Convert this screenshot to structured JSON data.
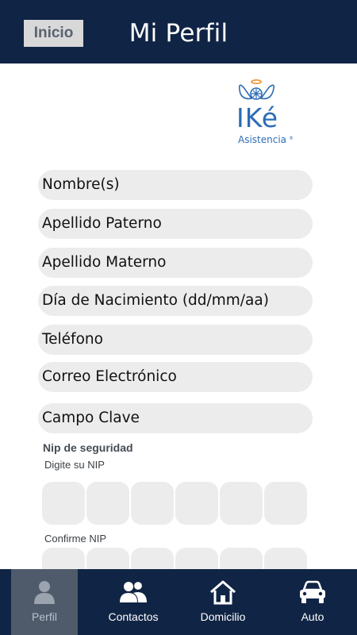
{
  "header": {
    "back_label": "Inicio",
    "title": "Mi Perfil"
  },
  "logo": {
    "text": "IKé",
    "subtitle": "Asistencia ®",
    "colors": {
      "primary": "#2b6cb5",
      "accent": "#f28e2b"
    }
  },
  "form": {
    "fields": [
      {
        "placeholder": "Nombre(s)",
        "value": ""
      },
      {
        "placeholder": "Apellido Paterno",
        "value": ""
      },
      {
        "placeholder": "Apellido Materno",
        "value": ""
      },
      {
        "placeholder": "Día de Nacimiento (dd/mm/aa)",
        "value": ""
      },
      {
        "placeholder": "Teléfono",
        "value": ""
      },
      {
        "placeholder": "Correo Electrónico",
        "value": ""
      },
      {
        "placeholder": "Campo Clave",
        "value": ""
      }
    ],
    "nip": {
      "title": "Nip de seguridad",
      "enter_label": "Digite su NIP",
      "confirm_label": "Confirme NIP",
      "digits": 6
    }
  },
  "bottom_nav": {
    "items": [
      {
        "label": "Perfil",
        "icon": "person-icon",
        "active": true
      },
      {
        "label": "Contactos",
        "icon": "contacts-icon",
        "active": false
      },
      {
        "label": "Domicilio",
        "icon": "home-icon",
        "active": false
      },
      {
        "label": "Auto",
        "icon": "car-icon",
        "active": false
      }
    ]
  },
  "colors": {
    "header_bg": "#102445",
    "nav_active_bg": "#4f5b6a",
    "field_bg": "#ececec"
  }
}
